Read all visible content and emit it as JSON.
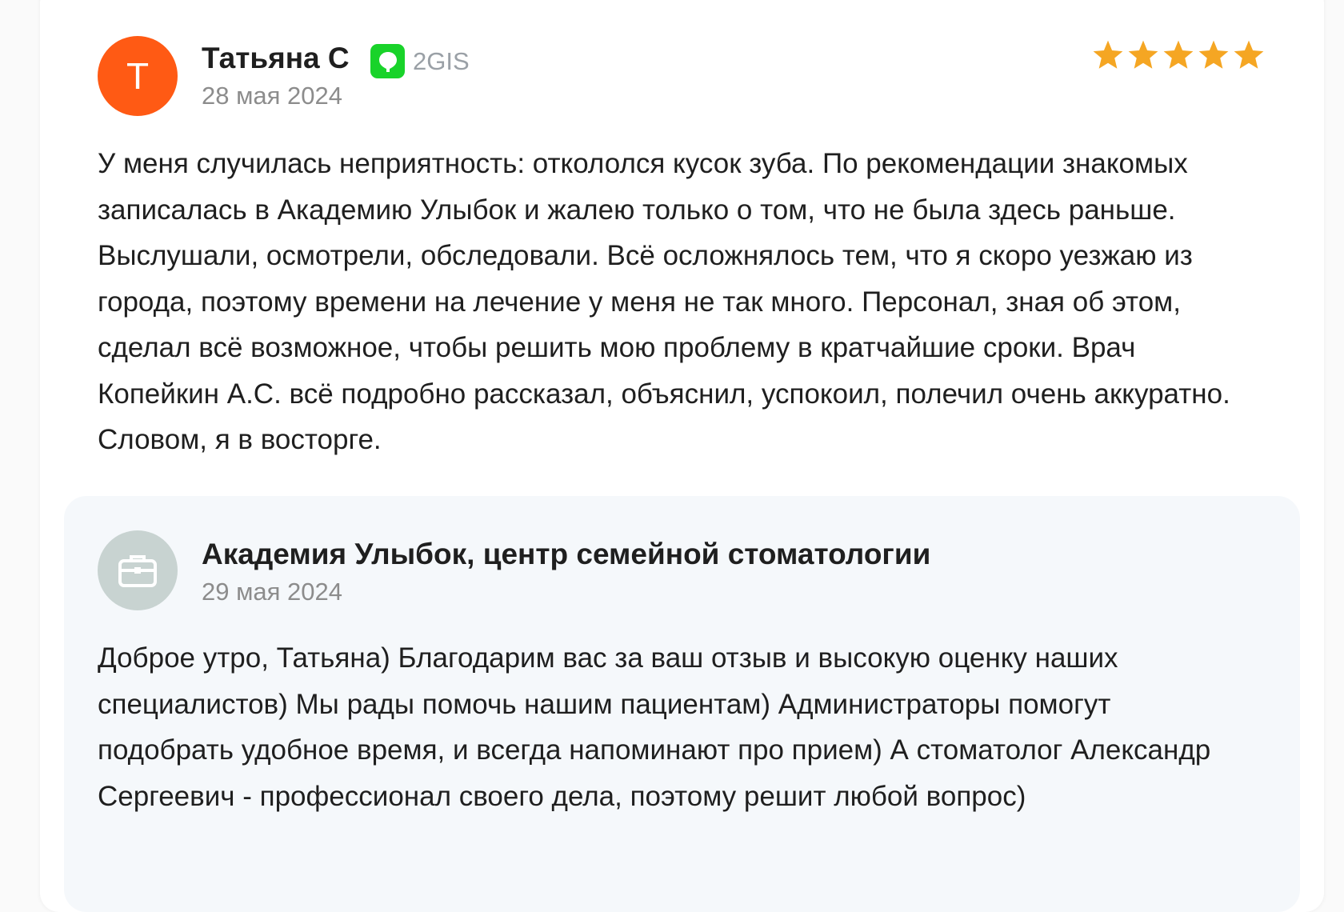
{
  "review": {
    "avatar_letter": "Т",
    "author": "Татьяна С",
    "source": "2GIS",
    "date": "28 мая 2024",
    "rating": 5,
    "text": "У меня случилась неприятность: откололся кусок зуба. По рекомендации знакомых записалась в Академию Улыбок и жалею только о том, что не была здесь раньше. Выслушали, осмотрели, обследовали. Всё осложнялось тем, что я скоро уезжаю из города, поэтому времени на лечение у меня не так много. Персонал, зная об этом, сделал всё возможное, чтобы решить мою проблему в кратчайшие сроки. Врач Копейкин А.С. всё подробно рассказал, объяснил, успокоил, полечил очень аккуратно. Словом, я в восторге."
  },
  "reply": {
    "author": "Академия Улыбок, центр семейной стоматологии",
    "date": "29 мая 2024",
    "text": "Доброе утро, Татьяна) Благодарим вас за ваш отзыв и высокую оценку наших специалистов) Мы рады помочь нашим пациентам) Администраторы помогут подобрать удобное время, и всегда напоминают про прием) А стоматолог Александр Сергеевич - профессионал своего дела, поэтому решит любой вопрос)"
  },
  "colors": {
    "avatar_user": "#ff5a14",
    "avatar_org": "#c8d3d1",
    "source_logo": "#19d32a",
    "star": "#f5a623",
    "reply_bg": "#f5f8fb"
  },
  "icons": {
    "source": "2gis-logo-icon",
    "star": "star-icon",
    "org": "briefcase-icon"
  }
}
